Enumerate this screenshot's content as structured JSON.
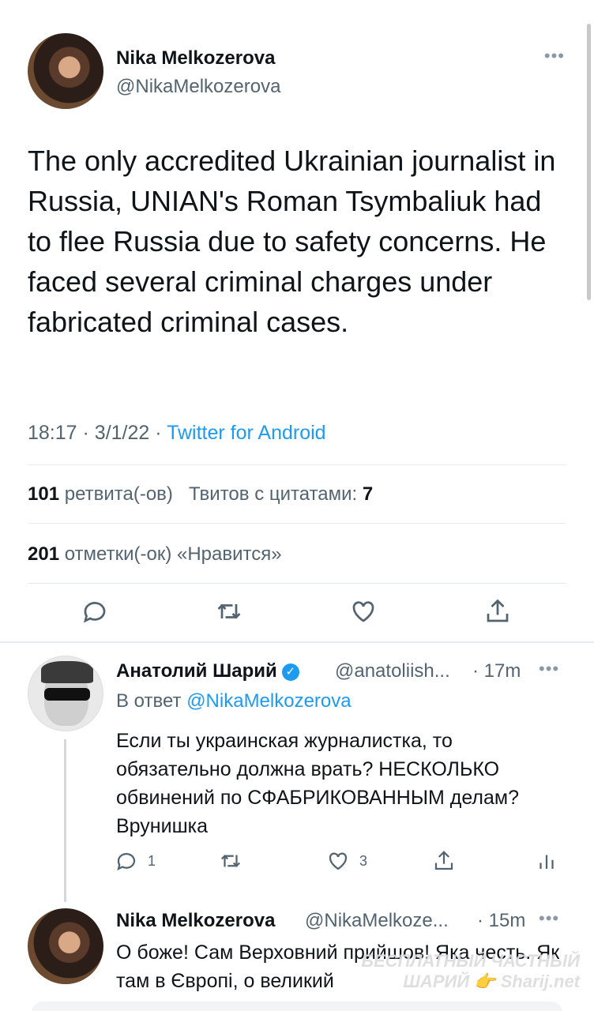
{
  "main_tweet": {
    "author_name": "Nika Melkozerova",
    "author_handle": "@NikaMelkozerova",
    "text": "The only accredited Ukrainian journalist in Russia, UNIAN's Roman Tsymbaliuk had to flee Russia due to safety concerns. He faced several criminal charges under fabricated criminal cases.",
    "time": "18:17",
    "date": "3/1/22",
    "source": "Twitter for Android",
    "retweets_count": "101",
    "retweets_label": "ретвита(-ов)",
    "quotes_label": "Твитов с цитатами:",
    "quotes_count": "7",
    "likes_count": "201",
    "likes_label": "отметки(-ок) «Нравится»",
    "more_label": "•••"
  },
  "reply1": {
    "author_name": "Анатолий Шарий",
    "author_handle": "@anatoliish...",
    "time": "· 17m",
    "in_reply_prefix": "В ответ",
    "in_reply_handle": "@NikaMelkozerova",
    "text": "Если ты украинская журналистка, то обязательно должна врать? НЕСКОЛЬКО обвинений по СФАБРИКОВАННЫМ делам? Врунишка",
    "reply_count": "1",
    "like_count": "3",
    "more_label": "•••"
  },
  "reply2": {
    "author_name": "Nika Melkozerova",
    "author_handle": "@NikaMelkoze...",
    "time": "· 15m",
    "text": "О боже! Сам Верховний прийшов! Яка честь. Як там в Європі, о великий",
    "more_label": "•••"
  },
  "watermark": {
    "line1": "БЕСПЛАТНЫЙ ЧАСТНЫЙ",
    "line2": "ШАРИЙ 👉 Sharij.net"
  },
  "colors": {
    "accent": "#1d9bf0",
    "secondary_text": "#536471",
    "divider": "#e6ecf0"
  }
}
